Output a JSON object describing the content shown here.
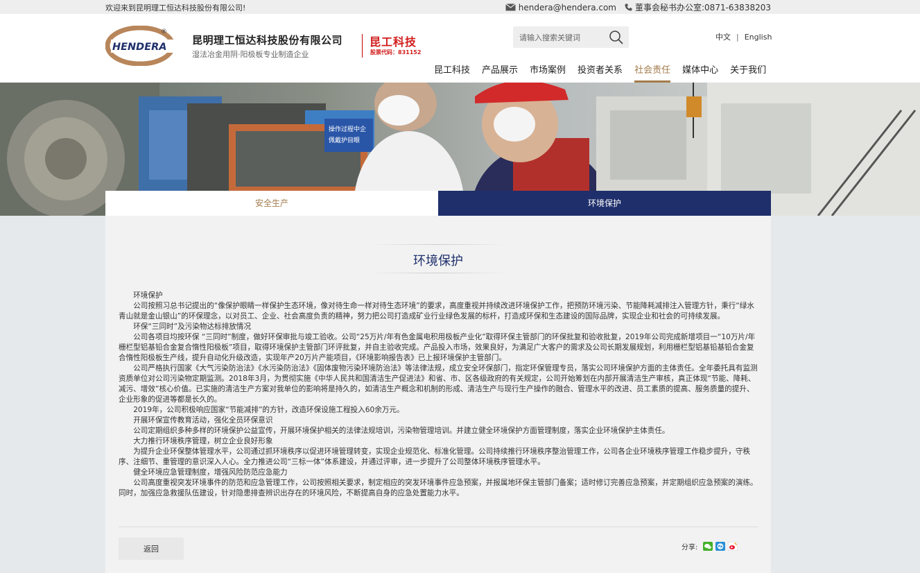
{
  "topbar": {
    "welcome": "欢迎来到昆明理工恒达科技股份有限公司!",
    "email": "hendera@hendera.com",
    "phone": "董事会秘书办公室:0871-63838203"
  },
  "header": {
    "logo_text": "HENDERA",
    "logo_registered": "®",
    "company_name": "昆明理工恒达科技股份有限公司",
    "slogan": "湿法冶金用阴·阳极板专业制造企业",
    "brand_short": "昆工科技",
    "stock_code": "股票代码：831152",
    "search_placeholder": "请输入搜索关键词",
    "lang_zh": "中文",
    "lang_sep": "|",
    "lang_en": "English"
  },
  "nav": {
    "items": [
      {
        "label": "昆工科技"
      },
      {
        "label": "产品展示"
      },
      {
        "label": "市场案例"
      },
      {
        "label": "投资者关系"
      },
      {
        "label": "社会责任"
      },
      {
        "label": "媒体中心"
      },
      {
        "label": "关于我们"
      }
    ],
    "active_index": 4
  },
  "banner": {
    "sign1": "操作过程中企",
    "sign2": "佩戴护目眼"
  },
  "tabs": [
    {
      "label": "安全生产"
    },
    {
      "label": "环境保护"
    }
  ],
  "article": {
    "title": "环境保护",
    "paragraphs": [
      "环境保护",
      "公司按照习总书记提出的“像保护眼睛一样保护生态环境，像对待生命一样对待生态环境”的要求，高度重视并持续改进环境保护工作，把预防环境污染、节能降耗减排注入管理方针，秉行“绿水青山就是金山银山”的环保理念，以对员工、企业、社会高度负责的精神，努力把公司打造成矿业行业绿色发展的标杆，打造成环保和生态建设的国际品牌，实现企业和社会的可持续发展。",
      "环保“三同时”及污染物达标排放情况",
      "公司各项目均按环保 “三同时”制度，做好环保审批与竣工验收。公司“25万片/年有色金属电积用极板产业化”取得环保主管部门的环保批复和验收批复，2019年公司完成新增项目一“10万片/年栅栏型铝基铅合金复合惰性阳极板”项目，取得环境保护主管部门环评批复，并自主验收完成。产品投入市场，效果良好，为满足广大客户的需求及公司长期发展规划，利用栅栏型铝基铅基铅合金复合惰性阳极板生产线，提升自动化升级改造，实现年产20万片产能项目，《环境影响报告表》已上报环境保护主管部门。",
      "公司严格执行国家《大气污染防治法》《水污染防治法》《固体废物污染环境防治法》等法律法规，成立安全环保部门，指定环保管理专员，落实公司环境保护方面的主体责任。全年委托具有监测资质单位对公司污染物定期监测。2018年3月，为贯彻实施《中华人民共和国清洁生产促进法》和省、市、区各级政府的有关规定，公司开始筹划在内部开展清洁生产审核，真正体现“节能、降耗、减污、增效”核心价值。已实施的清洁生产方案对我单位的影响将是持久的，如清洁生产概念和机制的形成、清洁生产与现行生产操作的融合、管理水平的改进、员工素质的提高、服务质量的提升、企业形象的促进等都是长久的。",
      "2019年，公司积极响应国家“节能减排”的方针，改造环保设施工程投入60余万元。",
      "开展环保宣传教育活动，强化全员环保意识",
      "公司定期组织多种多样的环境保护公益宣传，开展环境保护相关的法律法规培训，污染物管理培训。并建立健全环境保护方面管理制度，落实企业环境保护主体责任。",
      "大力推行环境秩序管理，树立企业良好形象",
      "为提升企业环保整体管理水平，公司通过抓环境秩序以促进环境管理转变，实现企业规范化、标准化管理。公司持续推行环境秩序整治管理工作，公司各企业环境秩序管理工作稳步提升，守秩序、注细节、重管理的意识深入人心。全力推进公司“三标一体”体系建设，并通过评审，进一步提升了公司整体环境秩序管理水平。",
      "健全环境应急管理制度，增强风险防范应急能力",
      "公司高度重视突发环境事件的防范和应急管理工作，公司按照相关要求，制定相应的突发环境事件应急预案，并报属地环保主管部门备案；适时修订完善应急预案，并定期组织应急预案的演练。同时，加强应急救援队伍建设，针对隐患排查辨识出存在的环境风险，不断提高自身的应急处置能力水平。"
    ]
  },
  "footer": {
    "back_label": "返回",
    "share_label": "分享:"
  },
  "colors": {
    "navy": "#1e2f6b",
    "gold": "#a37b4b",
    "brand_red": "#d21c1c"
  }
}
